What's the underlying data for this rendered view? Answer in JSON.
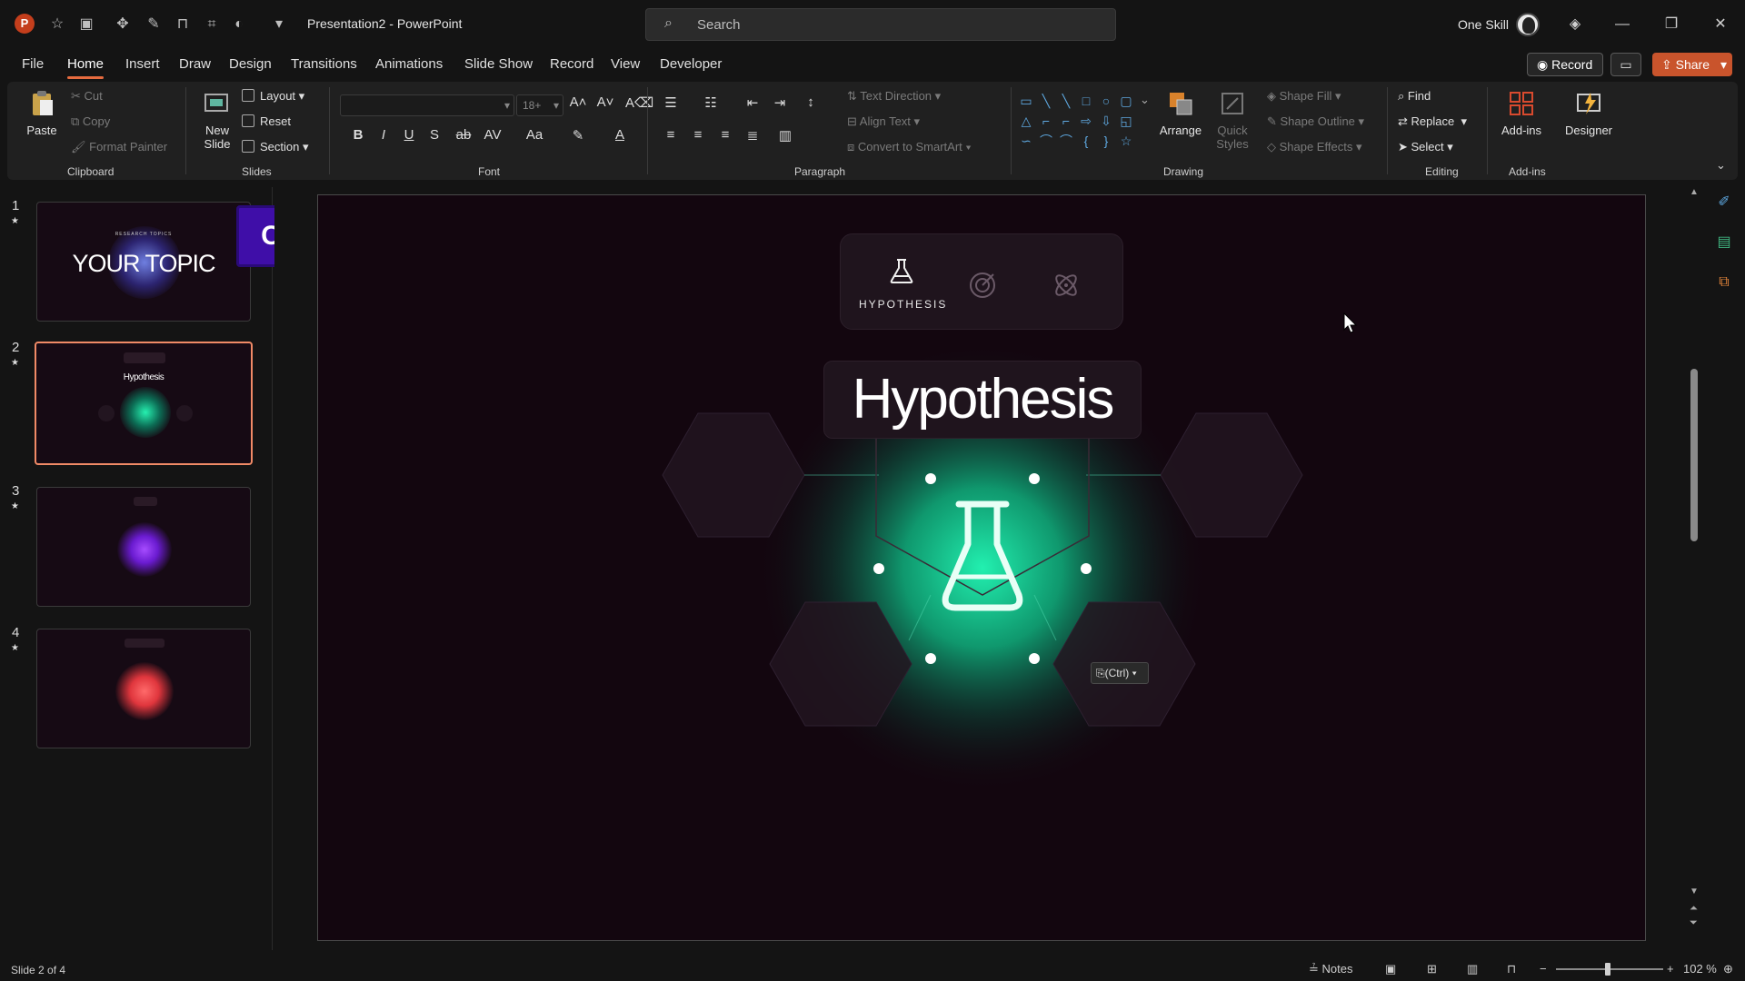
{
  "app": {
    "document_title": "Presentation2  -  PowerPoint",
    "user_name": "One Skill",
    "search_placeholder": "Search"
  },
  "menu_tabs": [
    "File",
    "Home",
    "Insert",
    "Draw",
    "Design",
    "Transitions",
    "Animations",
    "Slide Show",
    "Record",
    "View",
    "Developer"
  ],
  "active_tab": "Home",
  "header_buttons": {
    "record": "Record",
    "share": "Share"
  },
  "ribbon": {
    "clipboard": {
      "label": "Clipboard",
      "paste": "Paste",
      "cut": "Cut",
      "copy": "Copy",
      "format_painter": "Format Painter"
    },
    "slides": {
      "label": "Slides",
      "new_slide": "New Slide",
      "layout": "Layout",
      "reset": "Reset",
      "section": "Section"
    },
    "font": {
      "label": "Font",
      "size": "18+",
      "bold": "B",
      "italic": "I",
      "underline": "U",
      "shadow": "S",
      "strike": "ab",
      "spacing": "AV",
      "case": "Aa",
      "color": "A"
    },
    "paragraph": {
      "label": "Paragraph",
      "text_direction": "Text Direction",
      "align_text": "Align Text",
      "convert_smartart": "Convert to SmartArt"
    },
    "drawing": {
      "label": "Drawing",
      "arrange": "Arrange",
      "quick_styles": "Quick Styles",
      "shape_fill": "Shape Fill",
      "shape_outline": "Shape Outline",
      "shape_effects": "Shape Effects"
    },
    "editing": {
      "label": "Editing",
      "find": "Find",
      "replace": "Replace",
      "select": "Select"
    },
    "addins": {
      "label": "Add-ins",
      "addins": "Add-ins",
      "designer": "Designer"
    }
  },
  "slides": [
    {
      "num": "1",
      "title": "YOUR TOPIC",
      "subtitle": "RESEARCH TOPICS"
    },
    {
      "num": "2",
      "title": "Hypothesis"
    },
    {
      "num": "3"
    },
    {
      "num": "4"
    }
  ],
  "keystroke_overlay": "Ctrl + V",
  "current_slide": {
    "title": "Hypothesis",
    "nav_label": "HYPOTHESIS",
    "paste_tag": "(Ctrl)"
  },
  "statusbar": {
    "slide_info": "Slide 2 of 4",
    "notes": "Notes",
    "zoom": "102 %"
  },
  "colors": {
    "accent": "#e66b3f",
    "share": "#c9542c",
    "glow_green": "#19e0a0",
    "glow_purple": "#8a2be2",
    "glow_red": "#ff5a5f",
    "overlay": "#3f0ea8"
  },
  "icons": [
    "flask-icon",
    "target-icon",
    "atom-icon",
    "search-icon",
    "paste-icon"
  ]
}
